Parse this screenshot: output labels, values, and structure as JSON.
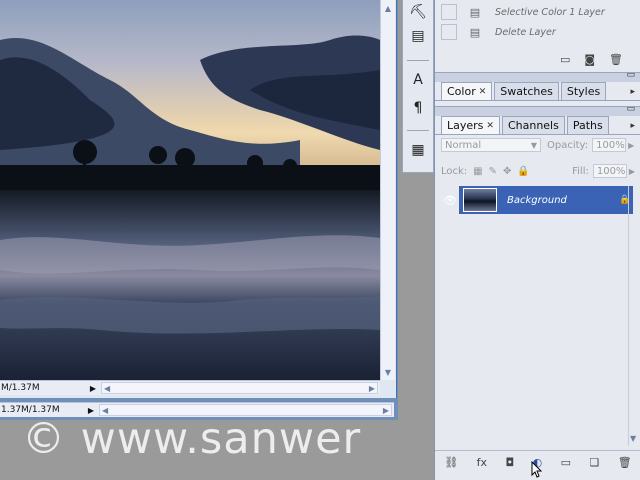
{
  "history": {
    "items": [
      {
        "label": "Selective Color 1 Layer",
        "icon": "document-icon"
      },
      {
        "label": "Delete Layer",
        "icon": "document-icon"
      }
    ]
  },
  "document": {
    "status_text": "M/1.37M",
    "status_text_back": "1.37M/1.37M"
  },
  "color_panel": {
    "tabs": [
      {
        "label": "Color",
        "active": true
      },
      {
        "label": "Swatches",
        "active": false
      },
      {
        "label": "Styles",
        "active": false
      }
    ]
  },
  "layers_panel": {
    "tabs": [
      {
        "label": "Layers",
        "active": true
      },
      {
        "label": "Channels",
        "active": false
      },
      {
        "label": "Paths",
        "active": false
      }
    ],
    "blend_mode": "Normal",
    "opacity_label": "Opacity:",
    "opacity_value": "100%",
    "lock_label": "Lock:",
    "fill_label": "Fill:",
    "fill_value": "100%",
    "layers": [
      {
        "name": "Background",
        "locked": true,
        "visible": true
      }
    ]
  },
  "watermark": "© www.sanwer"
}
